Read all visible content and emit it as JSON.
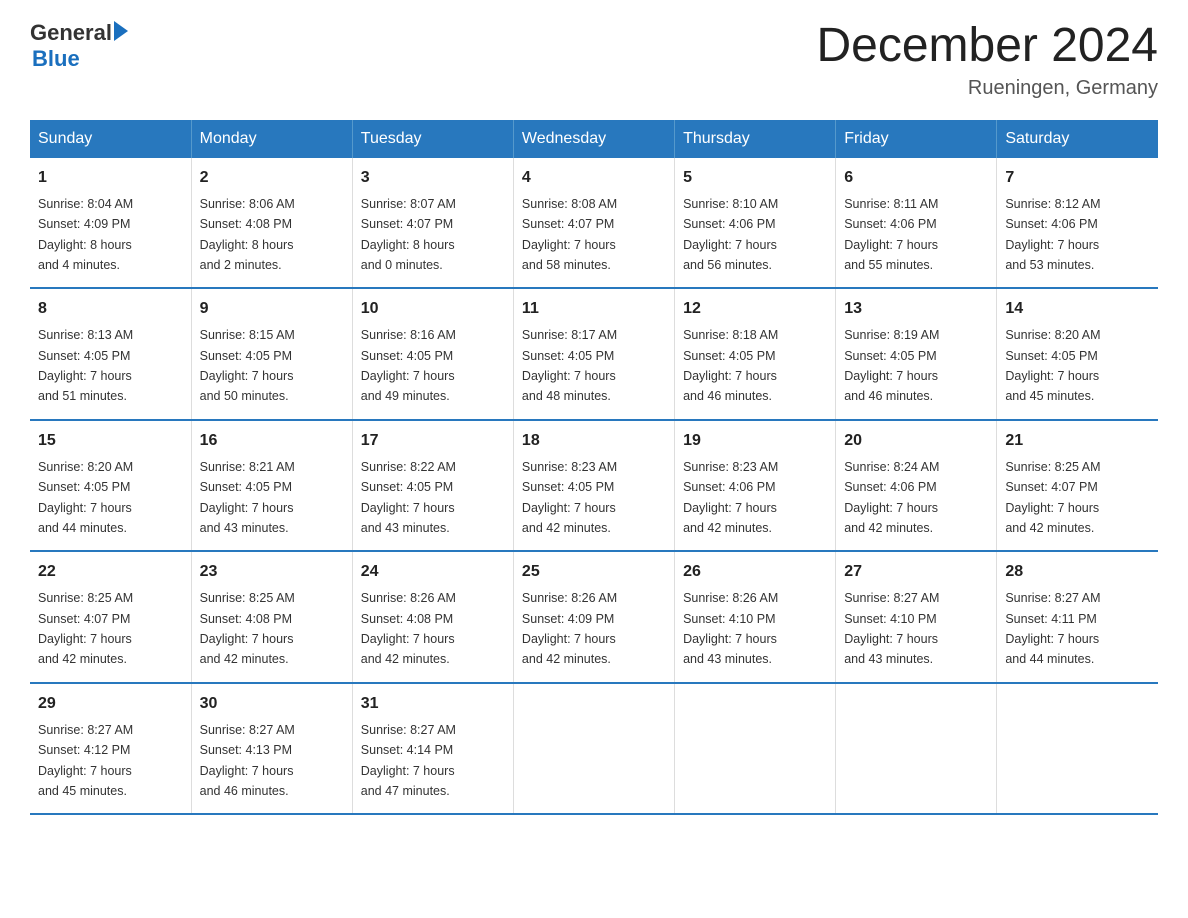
{
  "header": {
    "logo": {
      "general": "General",
      "blue": "Blue"
    },
    "title": "December 2024",
    "location": "Rueningen, Germany"
  },
  "weekdays": [
    "Sunday",
    "Monday",
    "Tuesday",
    "Wednesday",
    "Thursday",
    "Friday",
    "Saturday"
  ],
  "weeks": [
    [
      {
        "day": "1",
        "sunrise": "8:04 AM",
        "sunset": "4:09 PM",
        "daylight": "8 hours",
        "minutes": "and 4 minutes."
      },
      {
        "day": "2",
        "sunrise": "8:06 AM",
        "sunset": "4:08 PM",
        "daylight": "8 hours",
        "minutes": "and 2 minutes."
      },
      {
        "day": "3",
        "sunrise": "8:07 AM",
        "sunset": "4:07 PM",
        "daylight": "8 hours",
        "minutes": "and 0 minutes."
      },
      {
        "day": "4",
        "sunrise": "8:08 AM",
        "sunset": "4:07 PM",
        "daylight": "7 hours",
        "minutes": "and 58 minutes."
      },
      {
        "day": "5",
        "sunrise": "8:10 AM",
        "sunset": "4:06 PM",
        "daylight": "7 hours",
        "minutes": "and 56 minutes."
      },
      {
        "day": "6",
        "sunrise": "8:11 AM",
        "sunset": "4:06 PM",
        "daylight": "7 hours",
        "minutes": "and 55 minutes."
      },
      {
        "day": "7",
        "sunrise": "8:12 AM",
        "sunset": "4:06 PM",
        "daylight": "7 hours",
        "minutes": "and 53 minutes."
      }
    ],
    [
      {
        "day": "8",
        "sunrise": "8:13 AM",
        "sunset": "4:05 PM",
        "daylight": "7 hours",
        "minutes": "and 51 minutes."
      },
      {
        "day": "9",
        "sunrise": "8:15 AM",
        "sunset": "4:05 PM",
        "daylight": "7 hours",
        "minutes": "and 50 minutes."
      },
      {
        "day": "10",
        "sunrise": "8:16 AM",
        "sunset": "4:05 PM",
        "daylight": "7 hours",
        "minutes": "and 49 minutes."
      },
      {
        "day": "11",
        "sunrise": "8:17 AM",
        "sunset": "4:05 PM",
        "daylight": "7 hours",
        "minutes": "and 48 minutes."
      },
      {
        "day": "12",
        "sunrise": "8:18 AM",
        "sunset": "4:05 PM",
        "daylight": "7 hours",
        "minutes": "and 46 minutes."
      },
      {
        "day": "13",
        "sunrise": "8:19 AM",
        "sunset": "4:05 PM",
        "daylight": "7 hours",
        "minutes": "and 46 minutes."
      },
      {
        "day": "14",
        "sunrise": "8:20 AM",
        "sunset": "4:05 PM",
        "daylight": "7 hours",
        "minutes": "and 45 minutes."
      }
    ],
    [
      {
        "day": "15",
        "sunrise": "8:20 AM",
        "sunset": "4:05 PM",
        "daylight": "7 hours",
        "minutes": "and 44 minutes."
      },
      {
        "day": "16",
        "sunrise": "8:21 AM",
        "sunset": "4:05 PM",
        "daylight": "7 hours",
        "minutes": "and 43 minutes."
      },
      {
        "day": "17",
        "sunrise": "8:22 AM",
        "sunset": "4:05 PM",
        "daylight": "7 hours",
        "minutes": "and 43 minutes."
      },
      {
        "day": "18",
        "sunrise": "8:23 AM",
        "sunset": "4:05 PM",
        "daylight": "7 hours",
        "minutes": "and 42 minutes."
      },
      {
        "day": "19",
        "sunrise": "8:23 AM",
        "sunset": "4:06 PM",
        "daylight": "7 hours",
        "minutes": "and 42 minutes."
      },
      {
        "day": "20",
        "sunrise": "8:24 AM",
        "sunset": "4:06 PM",
        "daylight": "7 hours",
        "minutes": "and 42 minutes."
      },
      {
        "day": "21",
        "sunrise": "8:25 AM",
        "sunset": "4:07 PM",
        "daylight": "7 hours",
        "minutes": "and 42 minutes."
      }
    ],
    [
      {
        "day": "22",
        "sunrise": "8:25 AM",
        "sunset": "4:07 PM",
        "daylight": "7 hours",
        "minutes": "and 42 minutes."
      },
      {
        "day": "23",
        "sunrise": "8:25 AM",
        "sunset": "4:08 PM",
        "daylight": "7 hours",
        "minutes": "and 42 minutes."
      },
      {
        "day": "24",
        "sunrise": "8:26 AM",
        "sunset": "4:08 PM",
        "daylight": "7 hours",
        "minutes": "and 42 minutes."
      },
      {
        "day": "25",
        "sunrise": "8:26 AM",
        "sunset": "4:09 PM",
        "daylight": "7 hours",
        "minutes": "and 42 minutes."
      },
      {
        "day": "26",
        "sunrise": "8:26 AM",
        "sunset": "4:10 PM",
        "daylight": "7 hours",
        "minutes": "and 43 minutes."
      },
      {
        "day": "27",
        "sunrise": "8:27 AM",
        "sunset": "4:10 PM",
        "daylight": "7 hours",
        "minutes": "and 43 minutes."
      },
      {
        "day": "28",
        "sunrise": "8:27 AM",
        "sunset": "4:11 PM",
        "daylight": "7 hours",
        "minutes": "and 44 minutes."
      }
    ],
    [
      {
        "day": "29",
        "sunrise": "8:27 AM",
        "sunset": "4:12 PM",
        "daylight": "7 hours",
        "minutes": "and 45 minutes."
      },
      {
        "day": "30",
        "sunrise": "8:27 AM",
        "sunset": "4:13 PM",
        "daylight": "7 hours",
        "minutes": "and 46 minutes."
      },
      {
        "day": "31",
        "sunrise": "8:27 AM",
        "sunset": "4:14 PM",
        "daylight": "7 hours",
        "minutes": "and 47 minutes."
      },
      null,
      null,
      null,
      null
    ]
  ],
  "labels": {
    "sunrise": "Sunrise:",
    "sunset": "Sunset:",
    "daylight": "Daylight:"
  }
}
